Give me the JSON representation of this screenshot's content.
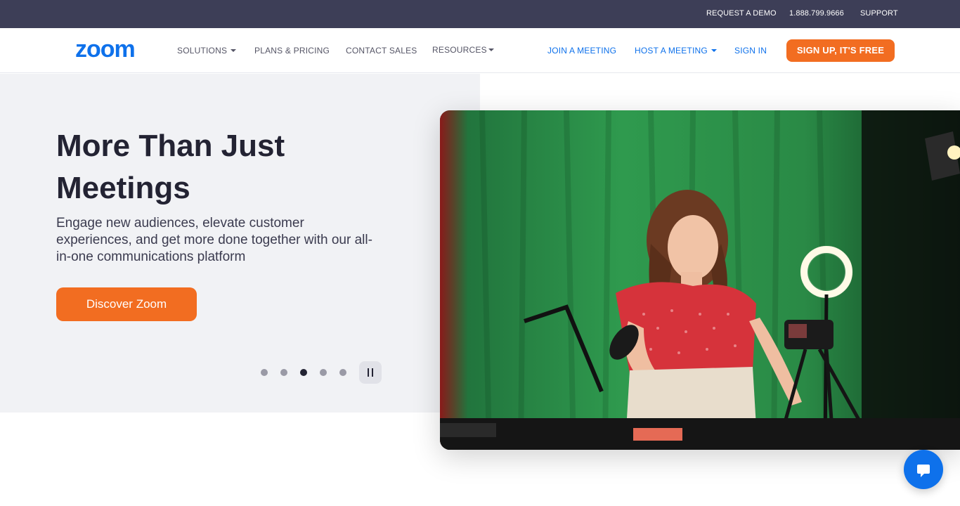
{
  "utility_bar": {
    "request_demo": "REQUEST A DEMO",
    "phone": "1.888.799.9666",
    "support": "SUPPORT"
  },
  "nav": {
    "logo_text": "zoom",
    "solutions": "SOLUTIONS",
    "plans": "PLANS & PRICING",
    "contact_sales": "CONTACT SALES",
    "resources": "RESOURCES",
    "join_meeting": "JOIN A MEETING",
    "host_meeting": "HOST A MEETING",
    "sign_in": "SIGN IN",
    "sign_up": "SIGN UP, IT'S FREE"
  },
  "hero": {
    "title": "More Than Just Meetings",
    "subtitle": "Engage new audiences, elevate customer experiences, and get more done together with our all-in-one communications platform",
    "cta": "Discover Zoom",
    "carousel": {
      "slide_count": 5,
      "active_slide": 3
    },
    "pause_icon": "pause-icon",
    "image_description_icon": "hero-photo"
  },
  "chat": {
    "icon": "chat-bubble-icon"
  },
  "colors": {
    "utility_bg": "#3d3e57",
    "brand_blue": "#0e71eb",
    "accent_orange": "#f26d21",
    "hero_bg": "#f1f2f5",
    "text_dark": "#232333"
  }
}
